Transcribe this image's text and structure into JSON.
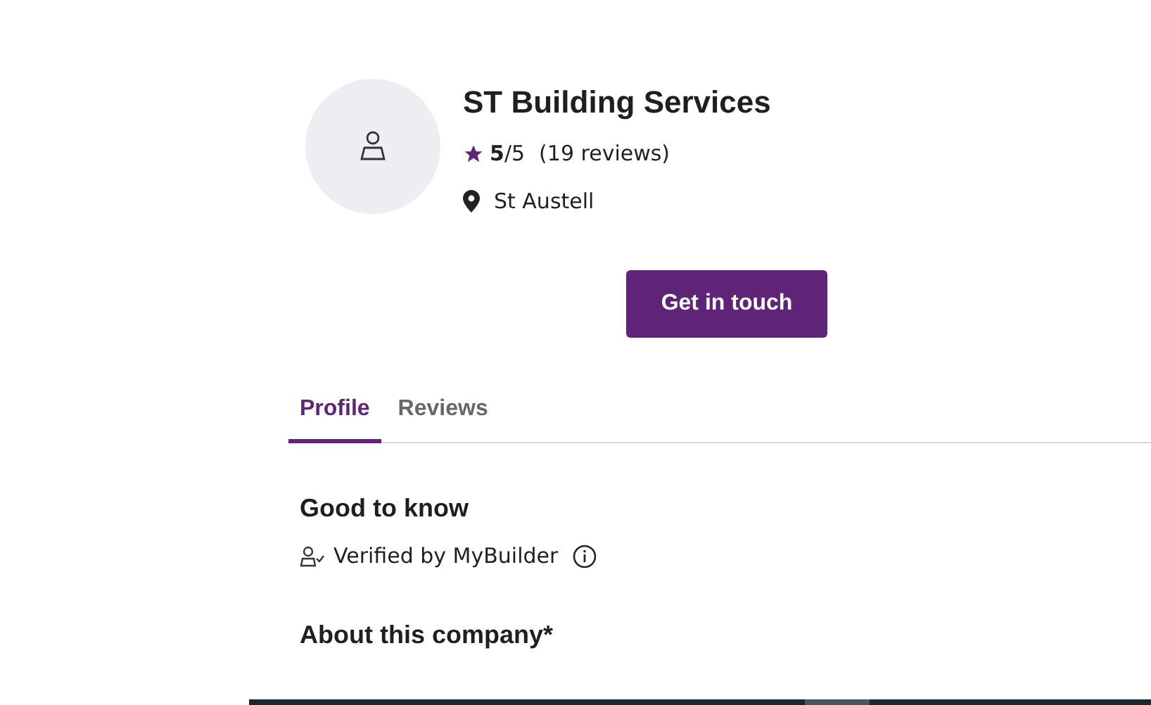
{
  "company": {
    "name": "ST Building Services",
    "rating": {
      "score": "5",
      "out_of": "/5",
      "reviews": "(19 reviews)"
    },
    "location": "St Austell"
  },
  "contact_button": "Get in touch",
  "tabs": [
    {
      "label": "Profile",
      "selected": true
    },
    {
      "label": "Reviews",
      "selected": false
    }
  ],
  "good_to_know": {
    "heading": "Good to know",
    "items": [
      {
        "text": "Verified by MyBuilder"
      }
    ]
  },
  "about": {
    "heading": "About this company*"
  }
}
